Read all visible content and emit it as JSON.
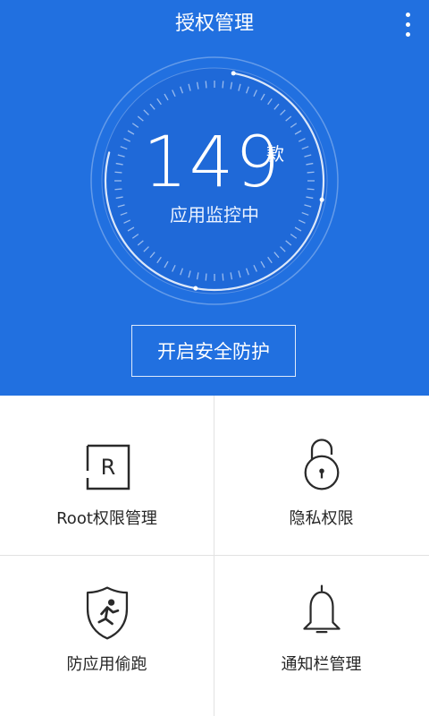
{
  "header": {
    "title": "授权管理",
    "menu_icon": "more-vertical-icon"
  },
  "monitor": {
    "count": "149",
    "unit": "款",
    "status": "应用监控中"
  },
  "protect_button": {
    "label": "开启安全防护"
  },
  "features": [
    {
      "label": "Root权限管理",
      "icon": "root-icon",
      "glyph": "R"
    },
    {
      "label": "隐私权限",
      "icon": "padlock-icon"
    },
    {
      "label": "防应用偷跑",
      "icon": "shield-runner-icon"
    },
    {
      "label": "通知栏管理",
      "icon": "bell-icon"
    }
  ],
  "colors": {
    "hero_background": "#2170e0",
    "text_dark": "#262626",
    "divider": "#e2e2e2"
  }
}
